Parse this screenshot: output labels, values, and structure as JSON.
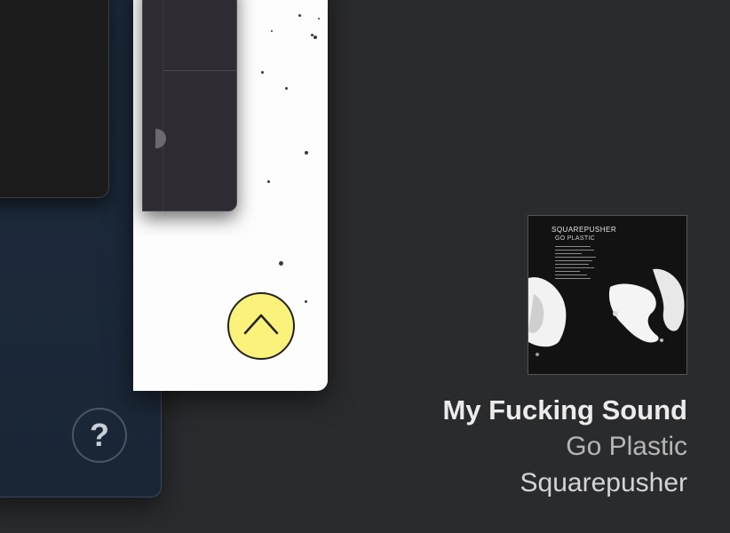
{
  "windows": {
    "help_button": {
      "label": "?",
      "icon": "question-icon"
    },
    "scroll_top_button": {
      "icon": "chevron-up-icon",
      "color": "#fbf27b"
    }
  },
  "now_playing": {
    "album_art": {
      "artist_text": "SQUAREPUSHER",
      "album_text": "GO PLASTIC"
    },
    "title": "My Fucking Sound",
    "album": "Go Plastic",
    "artist": "Squarepusher"
  },
  "colors": {
    "background": "#2a2b2d",
    "navy_window": "#1e2b3c",
    "white_window": "#fdfdfd",
    "accent_yellow": "#fbf27b"
  }
}
